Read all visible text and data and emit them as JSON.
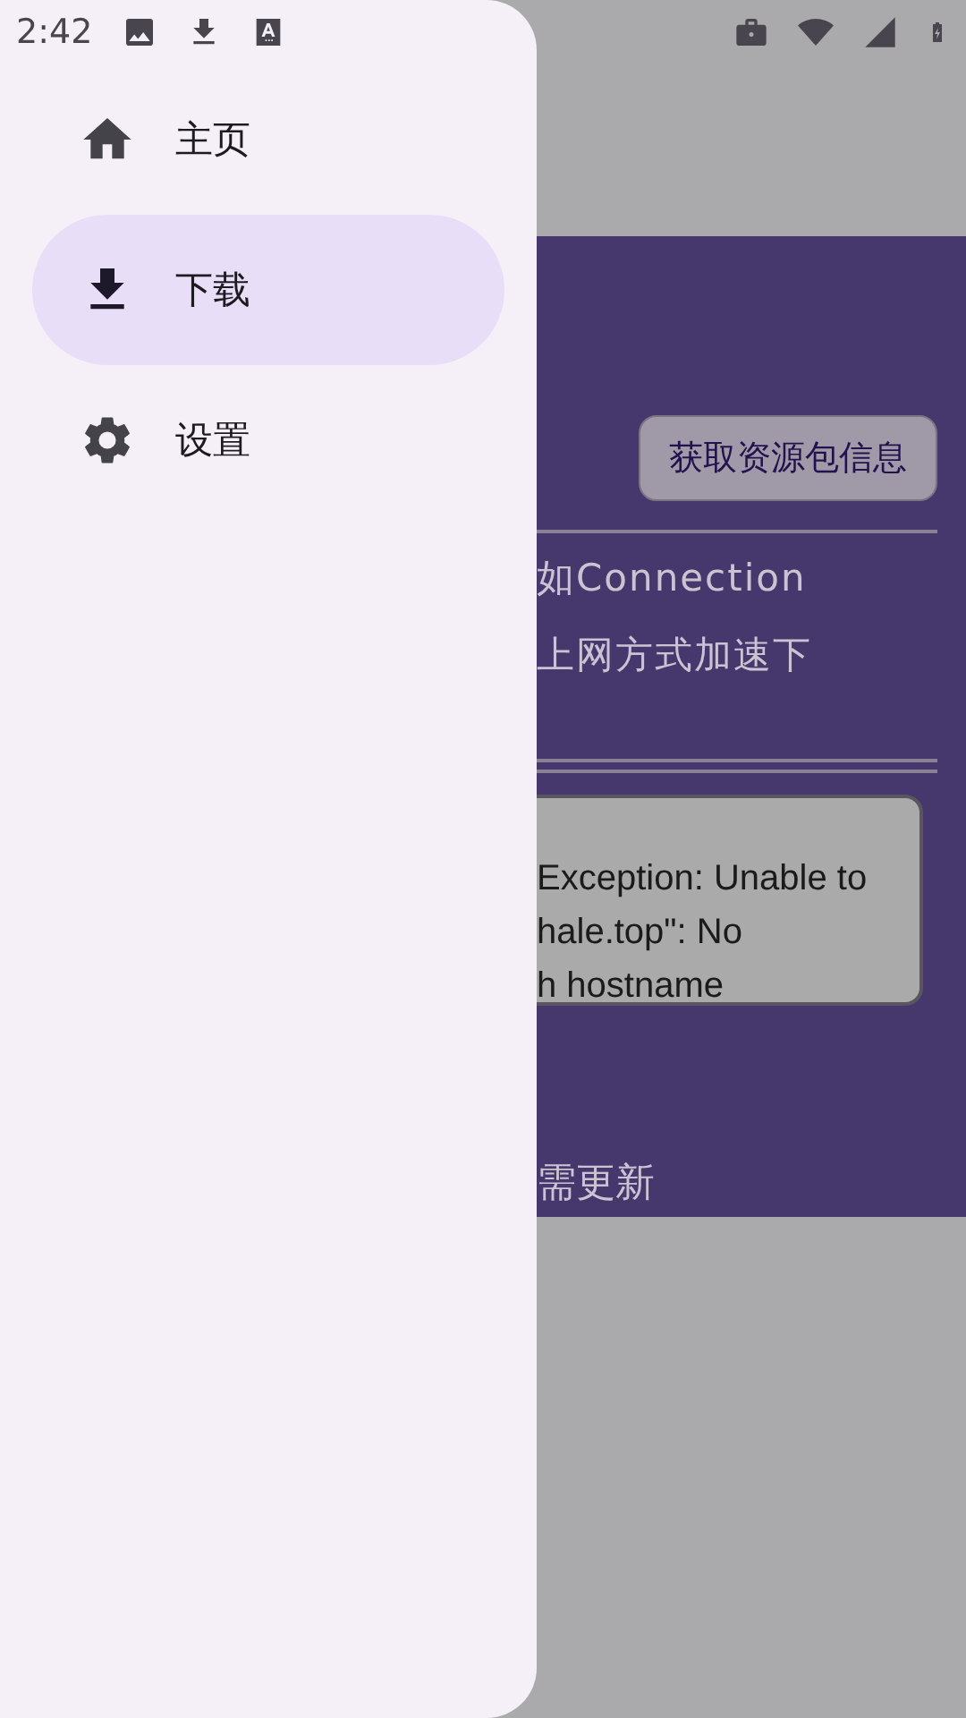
{
  "status_bar": {
    "time": "2:42"
  },
  "drawer": {
    "items": [
      {
        "label": "主页",
        "kind": "home",
        "selected": false
      },
      {
        "label": "下载",
        "kind": "download",
        "selected": true
      },
      {
        "label": "设置",
        "kind": "settings",
        "selected": false
      }
    ]
  },
  "page": {
    "button": "获取资源包信息",
    "notice_lines": [
      "如Connection",
      "上网方式加速下"
    ],
    "error_lines": [
      "Exception: Unable to",
      "hale.top\": No",
      "h hostname"
    ],
    "status_text": "需更新"
  }
}
